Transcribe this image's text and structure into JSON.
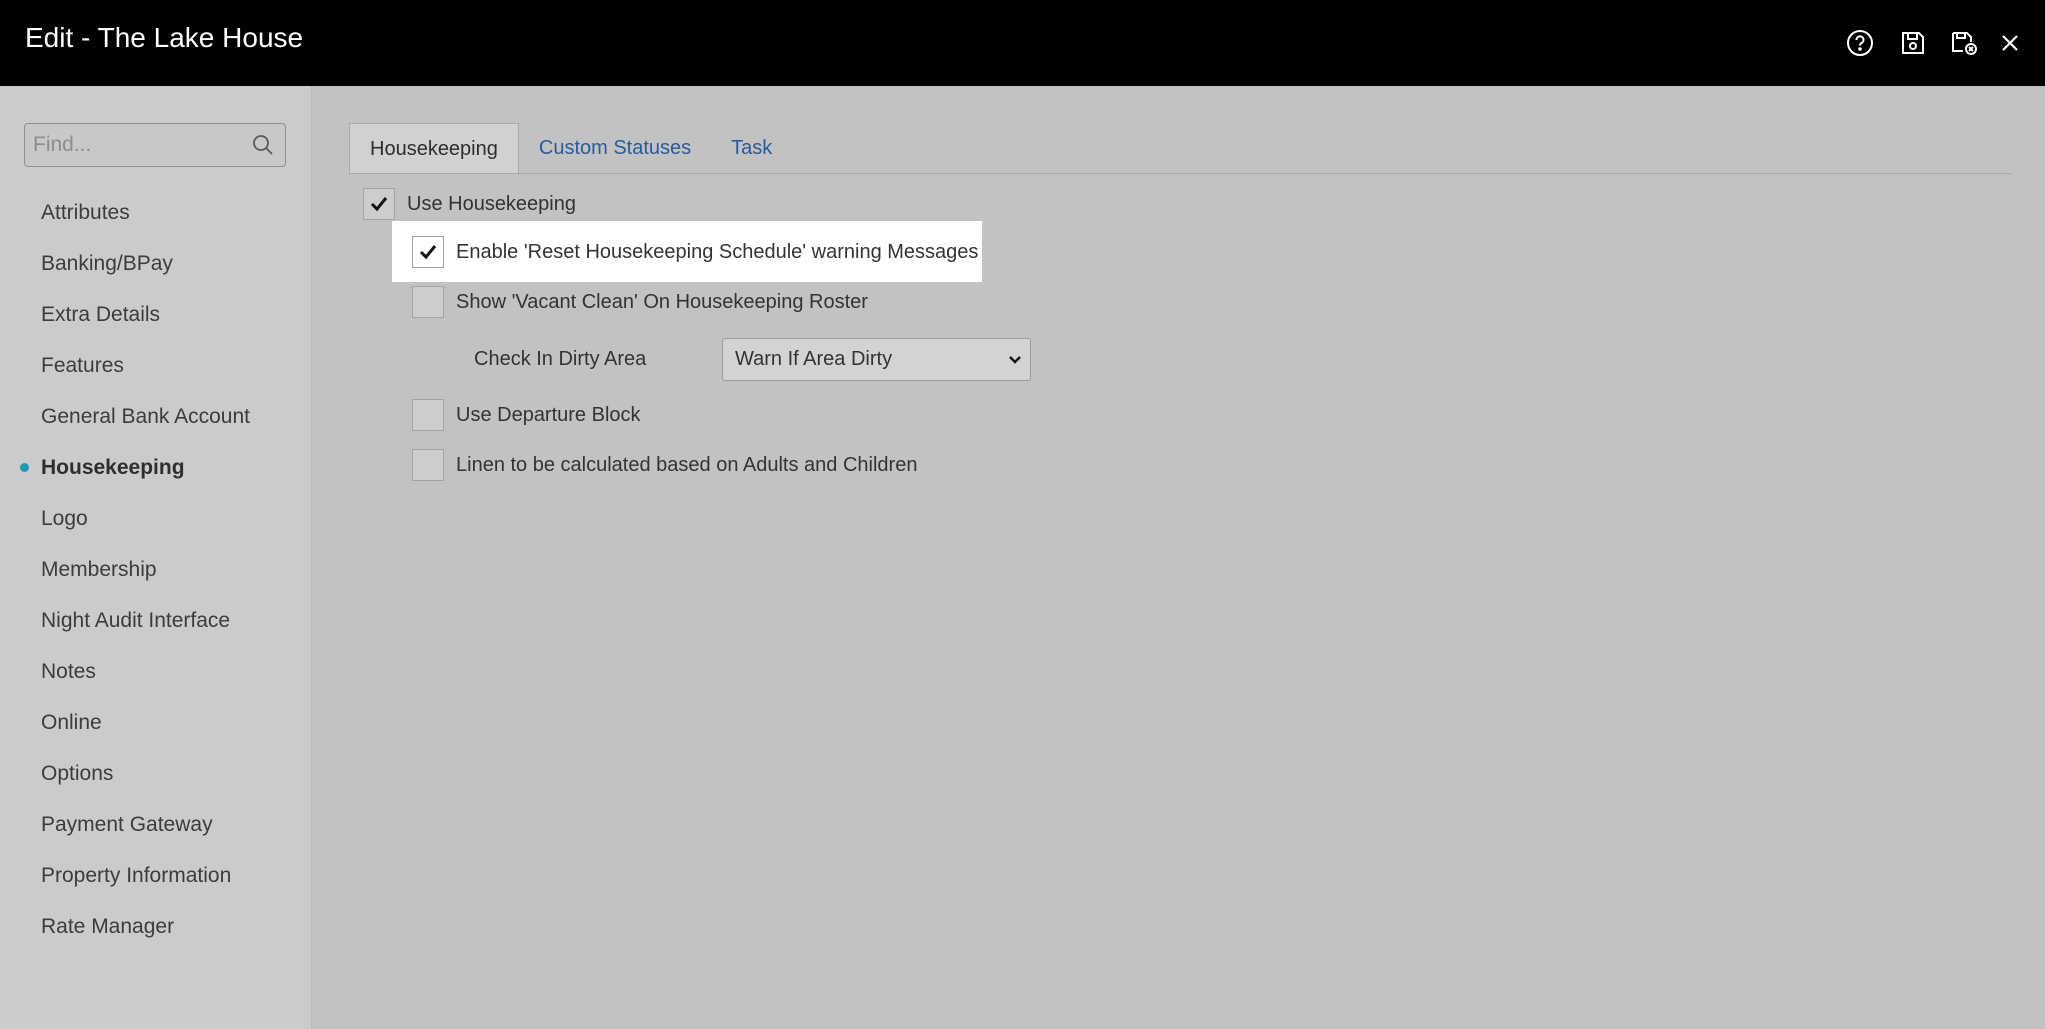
{
  "window": {
    "title": "Edit - The Lake House"
  },
  "toolbar": {
    "icons": [
      "help-icon",
      "save-icon",
      "save-and-close-icon",
      "close-icon"
    ]
  },
  "sidebar": {
    "search_placeholder": "Find...",
    "items": [
      {
        "label": "Attributes"
      },
      {
        "label": "Banking/BPay"
      },
      {
        "label": "Extra Details"
      },
      {
        "label": "Features"
      },
      {
        "label": "General Bank Account"
      },
      {
        "label": "Housekeeping",
        "active": true
      },
      {
        "label": "Logo"
      },
      {
        "label": "Membership"
      },
      {
        "label": "Night Audit Interface"
      },
      {
        "label": "Notes"
      },
      {
        "label": "Online"
      },
      {
        "label": "Options"
      },
      {
        "label": "Payment Gateway"
      },
      {
        "label": "Property Information"
      },
      {
        "label": "Rate Manager"
      }
    ],
    "active_color": "#1c9ab0"
  },
  "tabs": [
    {
      "label": "Housekeeping",
      "active": true
    },
    {
      "label": "Custom Statuses"
    },
    {
      "label": "Task"
    }
  ],
  "settings": {
    "use_housekeeping": {
      "label": "Use Housekeeping",
      "checked": true
    },
    "reset_warning": {
      "label": "Enable 'Reset Housekeeping Schedule' warning Messages",
      "checked": true
    },
    "show_vacant_clean": {
      "label": "Show 'Vacant Clean' On Housekeeping Roster",
      "checked": false
    },
    "check_in_dirty_area": {
      "label": "Check In Dirty Area",
      "value": "Warn If Area Dirty"
    },
    "use_departure_block": {
      "label": "Use Departure Block",
      "checked": false
    },
    "linen_calc": {
      "label": "Linen to be calculated based on Adults and Children",
      "checked": false
    }
  }
}
